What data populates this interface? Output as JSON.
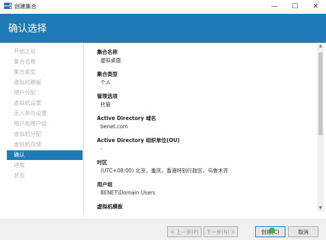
{
  "window": {
    "title": "创建集合",
    "minimize_glyph": "—",
    "maximize_glyph": "☐",
    "close_glyph": "✕"
  },
  "header": {
    "title": "确认选择"
  },
  "nav": {
    "items": [
      {
        "label": "开始之前",
        "active": false
      },
      {
        "label": "集合名称",
        "active": false
      },
      {
        "label": "集合类型",
        "active": false
      },
      {
        "label": "虚拟机模板",
        "active": false
      },
      {
        "label": "用户分配",
        "active": false
      },
      {
        "label": "虚拟机设置",
        "active": false
      },
      {
        "label": "无人参与设置",
        "active": false
      },
      {
        "label": "用户和用户组",
        "active": false
      },
      {
        "label": "虚拟机分配",
        "active": false
      },
      {
        "label": "虚拟机存储",
        "active": false
      },
      {
        "label": "确认",
        "active": true
      },
      {
        "label": "进度",
        "active": false
      },
      {
        "label": "状态",
        "active": false
      }
    ]
  },
  "fields": [
    {
      "label": "集合名称",
      "value": "虚拟桌面"
    },
    {
      "label": "集合类型",
      "value": "个人"
    },
    {
      "label": "管理选项",
      "value": "托管"
    },
    {
      "label": "Active Directory 域名",
      "value": "benet.com"
    },
    {
      "label": "Active Directory 组织单位(OU)",
      "value": "-"
    },
    {
      "label": "时区",
      "value": "(UTC+08:00) 北京，重庆，香港特别行政区，乌鲁木齐"
    },
    {
      "label": "用户组",
      "value": "BENET\\Domain Users"
    },
    {
      "label": "虚拟机模板",
      "value": ""
    }
  ],
  "buttons": {
    "prev": "< 上一步(P)",
    "next": "下一步(N) >",
    "create": "创建(C)",
    "cancel": "取消"
  },
  "colors": {
    "accent": "#1f7bb6",
    "nav_disabled": "#b5b5b5",
    "create_mark": "#39b54a"
  },
  "icons": {
    "title": "server-manager-icon",
    "scroll_up": "▲",
    "scroll_down": "▼"
  }
}
